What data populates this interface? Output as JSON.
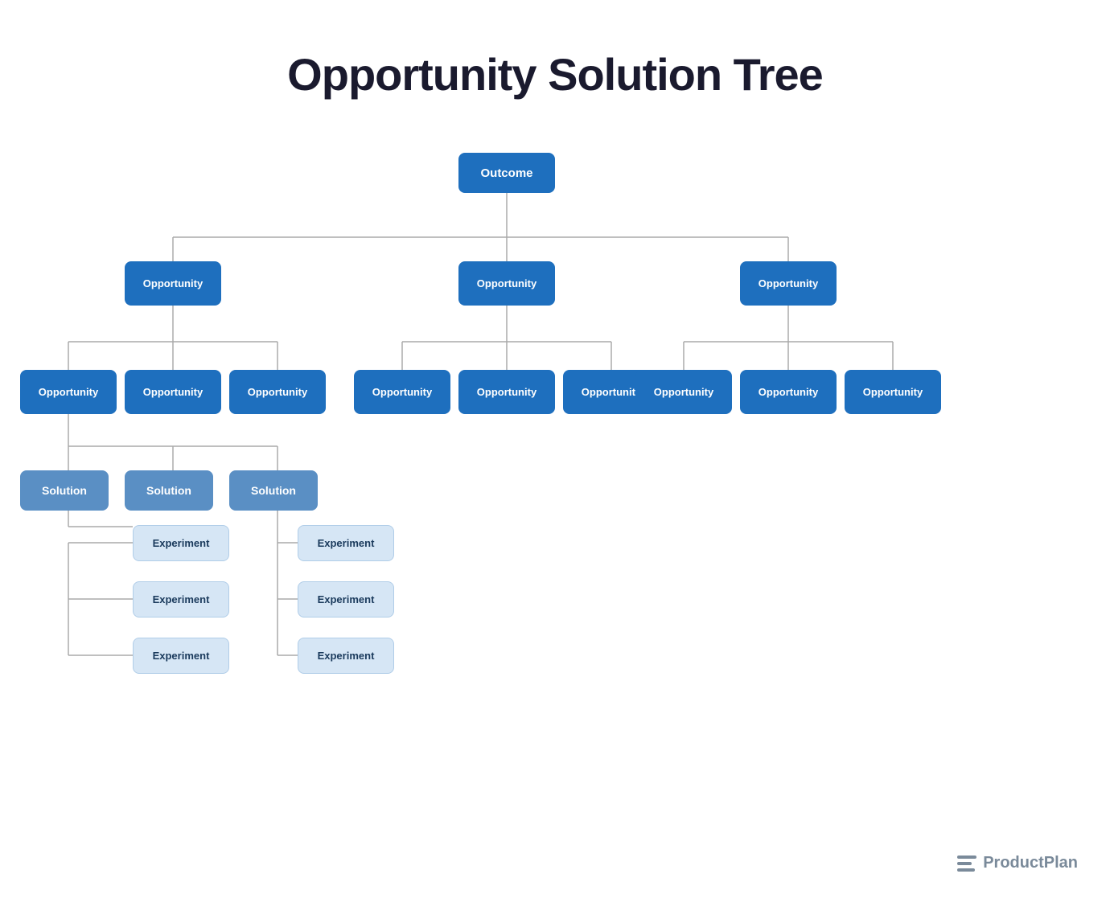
{
  "title": "Opportunity Solution Tree",
  "nodes": {
    "outcome": {
      "label": "Outcome"
    },
    "opp_left": {
      "label": "Opportunity"
    },
    "opp_center": {
      "label": "Opportunity"
    },
    "opp_right": {
      "label": "Opportunity"
    },
    "opp_ll": {
      "label": "Opportunity"
    },
    "opp_lc": {
      "label": "Opportunity"
    },
    "opp_lr": {
      "label": "Opportunity"
    },
    "opp_cl": {
      "label": "Opportunity"
    },
    "opp_cc": {
      "label": "Opportunity"
    },
    "opp_cr": {
      "label": "Opportunity"
    },
    "opp_rl": {
      "label": "Opportunity"
    },
    "opp_rc": {
      "label": "Opportunity"
    },
    "opp_rr": {
      "label": "Opportunity"
    },
    "sol_1": {
      "label": "Solution"
    },
    "sol_2": {
      "label": "Solution"
    },
    "sol_3": {
      "label": "Solution"
    },
    "exp_1_1": {
      "label": "Experiment"
    },
    "exp_1_2": {
      "label": "Experiment"
    },
    "exp_1_3": {
      "label": "Experiment"
    },
    "exp_3_1": {
      "label": "Experiment"
    },
    "exp_3_2": {
      "label": "Experiment"
    },
    "exp_3_3": {
      "label": "Experiment"
    }
  },
  "logo": {
    "text": "ProductPlan"
  }
}
